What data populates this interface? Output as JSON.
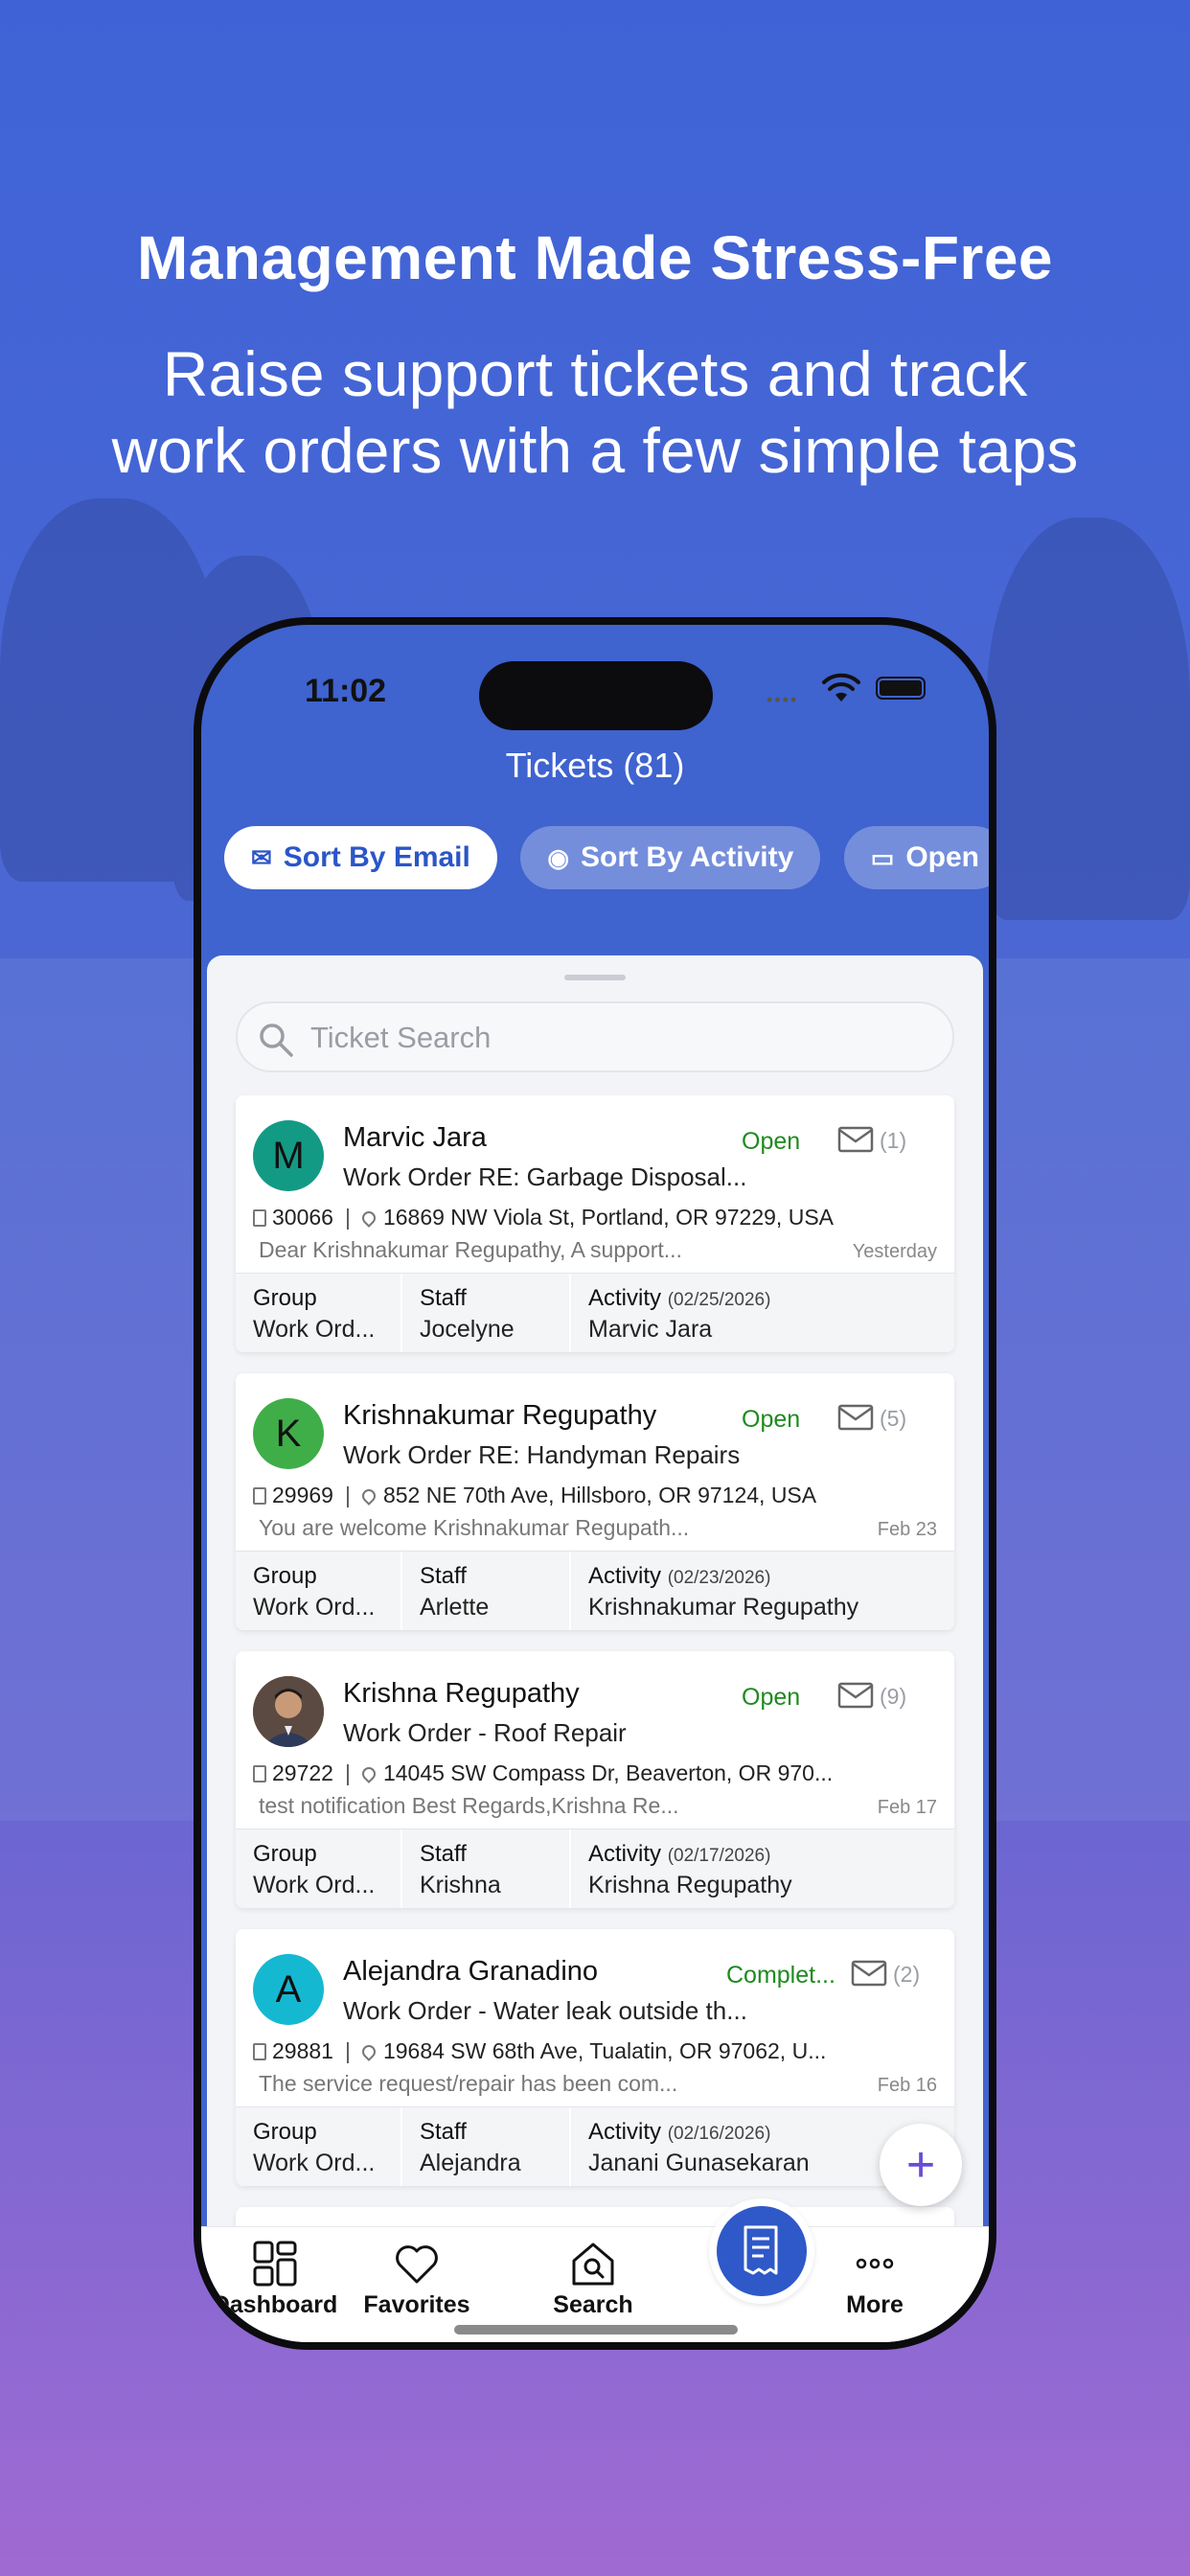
{
  "marketing": {
    "headline": "Management Made Stress-Free",
    "subheadline_line1": "Raise support tickets and track",
    "subheadline_line2": "work orders with a few simple taps"
  },
  "status_bar": {
    "time": "11:02"
  },
  "header": {
    "title": "Tickets (81)"
  },
  "filters": [
    {
      "label": "Sort By Email",
      "icon": "envelope-icon",
      "active": true
    },
    {
      "label": "Sort By Activity",
      "icon": "radio-icon",
      "active": false
    },
    {
      "label": "Open",
      "icon": "ticket-icon",
      "active": false
    }
  ],
  "search": {
    "placeholder": "Ticket Search",
    "value": ""
  },
  "column_labels": {
    "group": "Group",
    "staff": "Staff",
    "activity": "Activity"
  },
  "tickets": [
    {
      "initial": "M",
      "avatar_color": "#139a85",
      "name": "Marvic Jara",
      "status": "Open",
      "status_color": "#1f8a1f",
      "message_count": "(1)",
      "subject": "Work Order RE: Garbage Disposal...",
      "ticket_id": "30066",
      "address": "16869 NW Viola St, Portland, OR 97229, USA",
      "preview": "Dear Krishnakumar Regupathy, A support...",
      "date": "Yesterday",
      "group": "Work Ord...",
      "staff": "Jocelyne",
      "activity_date": "(02/25/2026)",
      "activity_by": "Marvic Jara"
    },
    {
      "initial": "K",
      "avatar_color": "#3fae49",
      "name": "Krishnakumar Regupathy",
      "status": "Open",
      "status_color": "#1f8a1f",
      "message_count": "(5)",
      "subject": "Work Order RE: Handyman Repairs",
      "ticket_id": "29969",
      "address": "852 NE 70th Ave, Hillsboro, OR 97124, USA",
      "preview": "You are welcome Krishnakumar Regupath...",
      "date": "Feb 23",
      "group": "Work Ord...",
      "staff": "Arlette",
      "activity_date": "(02/23/2026)",
      "activity_by": "Krishnakumar Regupathy"
    },
    {
      "initial": "",
      "avatar_color": "#7a5a48",
      "name": "Krishna Regupathy",
      "status": "Open",
      "status_color": "#1f8a1f",
      "message_count": "(9)",
      "subject": "Work Order - Roof Repair",
      "ticket_id": "29722",
      "address": "14045 SW Compass Dr, Beaverton, OR 970...",
      "preview": "test notification Best Regards,Krishna Re...",
      "date": "Feb 17",
      "group": "Work Ord...",
      "staff": "Krishna",
      "activity_date": "(02/17/2026)",
      "activity_by": "Krishna Regupathy"
    },
    {
      "initial": "A",
      "avatar_color": "#15b8d1",
      "name": "Alejandra Granadino",
      "status": "Complet...",
      "status_color": "#1f8a1f",
      "message_count": "(2)",
      "subject": "Work Order - Water leak outside th...",
      "ticket_id": "29881",
      "address": "19684 SW 68th Ave, Tualatin, OR 97062, U...",
      "preview": "The service request/repair has been com...",
      "date": "Feb 16",
      "group": "Work Ord...",
      "staff": "Alejandra",
      "activity_date": "(02/16/2026)",
      "activity_by": "Janani Gunasekaran"
    }
  ],
  "fab": {
    "label": "+"
  },
  "tabbar": [
    {
      "label": "Dashboard",
      "icon": "dashboard-icon"
    },
    {
      "label": "Favorites",
      "icon": "heart-icon"
    },
    {
      "label": "Search",
      "icon": "home-search-icon"
    },
    {
      "label": "",
      "icon": "tickets-icon"
    },
    {
      "label": "More",
      "icon": "more-icon"
    }
  ],
  "colors": {
    "primary": "#2f58c8",
    "header_bg": "#3f63cf",
    "status_open": "#1f8a1f"
  }
}
